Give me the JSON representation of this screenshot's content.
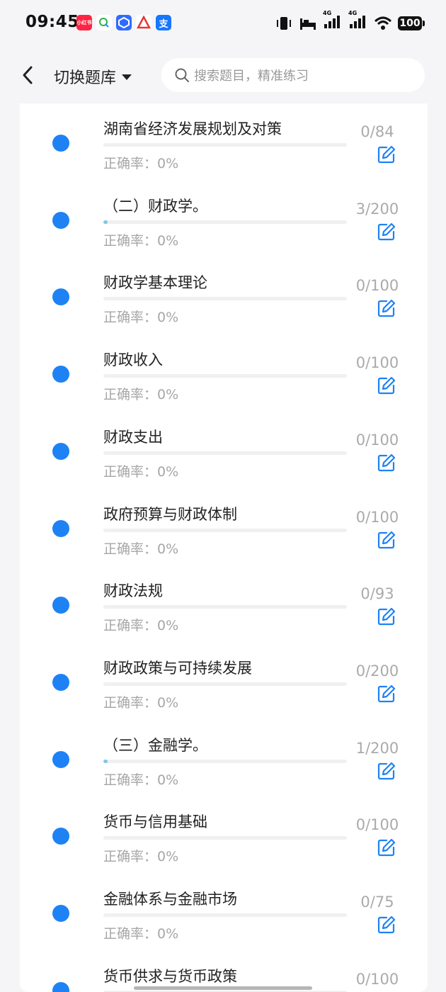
{
  "status_bar": {
    "time": "09:45",
    "network_1": "4G",
    "network_2": "4G",
    "battery": "100",
    "app_icons": [
      {
        "name": "xiaohongshu-icon",
        "color": "#ff2442",
        "text": "小红书"
      },
      {
        "name": "chat-icon",
        "color": "#ffffff",
        "text": ""
      },
      {
        "name": "app-blue-icon",
        "color": "#2f6bff",
        "text": ""
      },
      {
        "name": "app-red-icon",
        "color": "#ffffff",
        "text": ""
      },
      {
        "name": "alipay-icon",
        "color": "#1677ff",
        "text": "支"
      }
    ]
  },
  "header": {
    "switch_label": "切换题库",
    "search_placeholder": "搜索题目，精准练习"
  },
  "colors": {
    "accent": "#1e82f5",
    "progress_fill": "#7dc7e6",
    "muted_text": "#a6a6a6"
  },
  "items": [
    {
      "title": "湖南省经济发展规划及对策",
      "accuracy": "正确率：0%",
      "count": "0/84",
      "progress": 0
    },
    {
      "title": "（二）财政学。",
      "accuracy": "正确率：0%",
      "count": "3/200",
      "progress": 0.015
    },
    {
      "title": "财政学基本理论",
      "accuracy": "正确率：0%",
      "count": "0/100",
      "progress": 0
    },
    {
      "title": "财政收入",
      "accuracy": "正确率：0%",
      "count": "0/100",
      "progress": 0
    },
    {
      "title": "财政支出",
      "accuracy": "正确率：0%",
      "count": "0/100",
      "progress": 0
    },
    {
      "title": "政府预算与财政体制",
      "accuracy": "正确率：0%",
      "count": "0/100",
      "progress": 0
    },
    {
      "title": "财政法规",
      "accuracy": "正确率：0%",
      "count": "0/93",
      "progress": 0
    },
    {
      "title": "财政政策与可持续发展",
      "accuracy": "正确率：0%",
      "count": "0/200",
      "progress": 0
    },
    {
      "title": "（三）金融学。",
      "accuracy": "正确率：0%",
      "count": "1/200",
      "progress": 0.005
    },
    {
      "title": "货币与信用基础",
      "accuracy": "正确率：0%",
      "count": "0/100",
      "progress": 0
    },
    {
      "title": "金融体系与金融市场",
      "accuracy": "正确率：0%",
      "count": "0/75",
      "progress": 0
    },
    {
      "title": "货币供求与货币政策",
      "accuracy": "",
      "count": "0/100",
      "progress": 0
    }
  ]
}
